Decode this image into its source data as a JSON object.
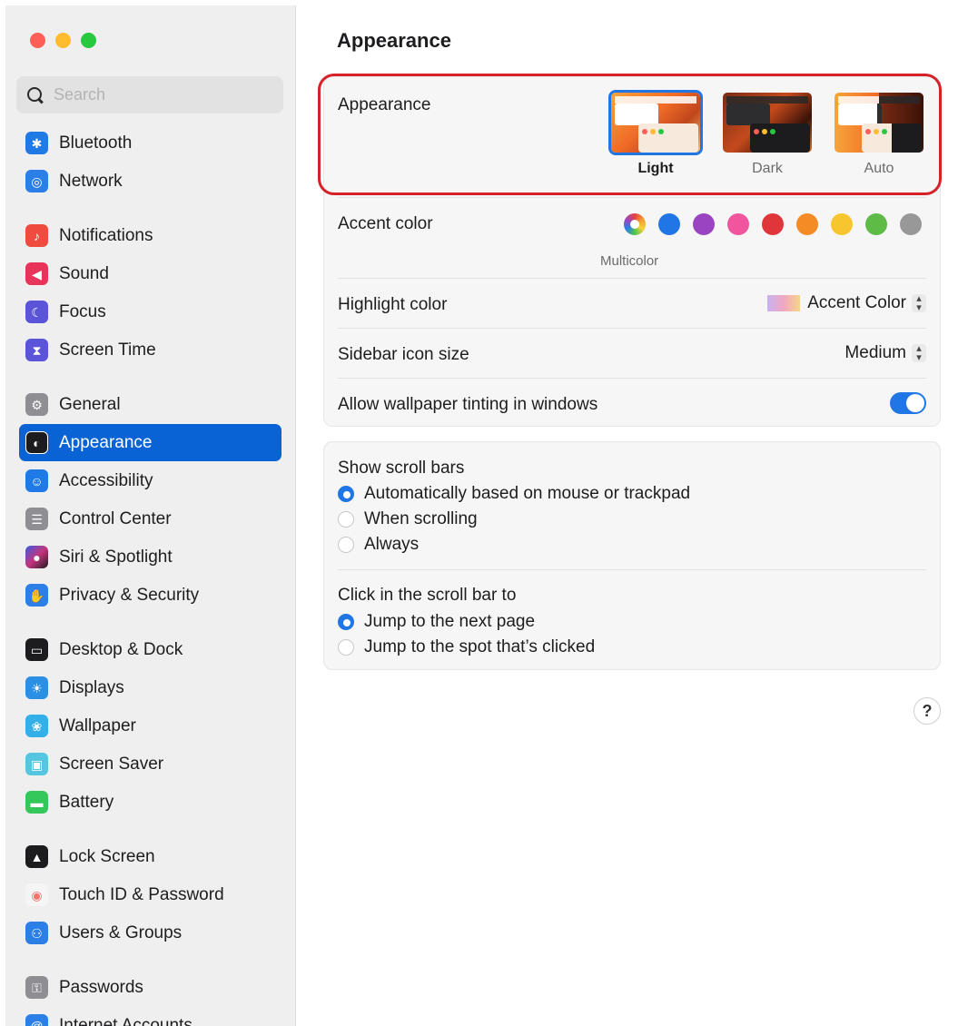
{
  "window": {
    "traffic_lights": [
      {
        "name": "close",
        "color": "#ff5f57"
      },
      {
        "name": "minimize",
        "color": "#febc2e"
      },
      {
        "name": "zoom",
        "color": "#28c840"
      }
    ]
  },
  "search": {
    "placeholder": "Search"
  },
  "sidebar": {
    "items": [
      {
        "label": "Bluetooth",
        "icon": "bluetooth-icon",
        "color": "#1f7ae6",
        "glyph": "✱"
      },
      {
        "label": "Network",
        "icon": "globe-icon",
        "color": "#2b7fe6",
        "glyph": "◎"
      },
      {
        "label": "Notifications",
        "icon": "bell-icon",
        "color": "#f04b3f",
        "glyph": "♪"
      },
      {
        "label": "Sound",
        "icon": "speaker-icon",
        "color": "#e8335a",
        "glyph": "◀"
      },
      {
        "label": "Focus",
        "icon": "moon-icon",
        "color": "#5b54d8",
        "glyph": "☾"
      },
      {
        "label": "Screen Time",
        "icon": "hourglass-icon",
        "color": "#5b54d8",
        "glyph": "⧗"
      },
      {
        "label": "General",
        "icon": "gear-icon",
        "color": "#8e8e93",
        "glyph": "⚙"
      },
      {
        "label": "Appearance",
        "icon": "appearance-icon",
        "color": "#1c1c1e",
        "glyph": "◐"
      },
      {
        "label": "Accessibility",
        "icon": "accessibility-icon",
        "color": "#1f7ae6",
        "glyph": "☺"
      },
      {
        "label": "Control Center",
        "icon": "control-center-icon",
        "color": "#8e8e93",
        "glyph": "☰"
      },
      {
        "label": "Siri & Spotlight",
        "icon": "siri-icon",
        "color": "#b0368f",
        "glyph": "●"
      },
      {
        "label": "Privacy & Security",
        "icon": "hand-icon",
        "color": "#2b7fe6",
        "glyph": "✋"
      },
      {
        "label": "Desktop & Dock",
        "icon": "dock-icon",
        "color": "#1c1c1e",
        "glyph": "▭"
      },
      {
        "label": "Displays",
        "icon": "sun-icon",
        "color": "#2b8fe6",
        "glyph": "☀"
      },
      {
        "label": "Wallpaper",
        "icon": "flower-icon",
        "color": "#33b0e8",
        "glyph": "❀"
      },
      {
        "label": "Screen Saver",
        "icon": "screen-saver-icon",
        "color": "#56c6e0",
        "glyph": "▣"
      },
      {
        "label": "Battery",
        "icon": "battery-icon",
        "color": "#34c759",
        "glyph": "▬"
      },
      {
        "label": "Lock Screen",
        "icon": "lock-icon",
        "color": "#1c1c1e",
        "glyph": "🔒"
      },
      {
        "label": "Touch ID & Password",
        "icon": "fingerprint-icon",
        "color": "#f0736f",
        "glyph": "◉"
      },
      {
        "label": "Users & Groups",
        "icon": "users-icon",
        "color": "#2b7fe6",
        "glyph": "⚇"
      },
      {
        "label": "Passwords",
        "icon": "key-icon",
        "color": "#8e8e93",
        "glyph": "⚿"
      },
      {
        "label": "Internet Accounts",
        "icon": "at-icon",
        "color": "#2b7fe6",
        "glyph": "@"
      }
    ],
    "active": "Appearance"
  },
  "main": {
    "title": "Appearance",
    "appearance": {
      "label": "Appearance",
      "options": [
        {
          "label": "Light",
          "selected": true
        },
        {
          "label": "Dark",
          "selected": false
        },
        {
          "label": "Auto",
          "selected": false
        }
      ]
    },
    "accent": {
      "label": "Accent color",
      "selected_name": "Multicolor",
      "swatches": [
        "multicolor",
        "#1f76e4",
        "#9b44c2",
        "#f0559e",
        "#e0363b",
        "#f58b24",
        "#f7c62e",
        "#5dbb46",
        "#989898"
      ]
    },
    "highlight": {
      "label": "Highlight color",
      "value": "Accent Color"
    },
    "sidebar_icon_size": {
      "label": "Sidebar icon size",
      "value": "Medium"
    },
    "wallpaper_tinting": {
      "label": "Allow wallpaper tinting in windows",
      "on": true
    },
    "scroll_bars": {
      "label": "Show scroll bars",
      "options": [
        {
          "label": "Automatically based on mouse or trackpad",
          "selected": true
        },
        {
          "label": "When scrolling",
          "selected": false
        },
        {
          "label": "Always",
          "selected": false
        }
      ]
    },
    "click_scroll": {
      "label": "Click in the scroll bar to",
      "options": [
        {
          "label": "Jump to the next page",
          "selected": true
        },
        {
          "label": "Jump to the spot that’s clicked",
          "selected": false
        }
      ]
    },
    "help_label": "?"
  }
}
